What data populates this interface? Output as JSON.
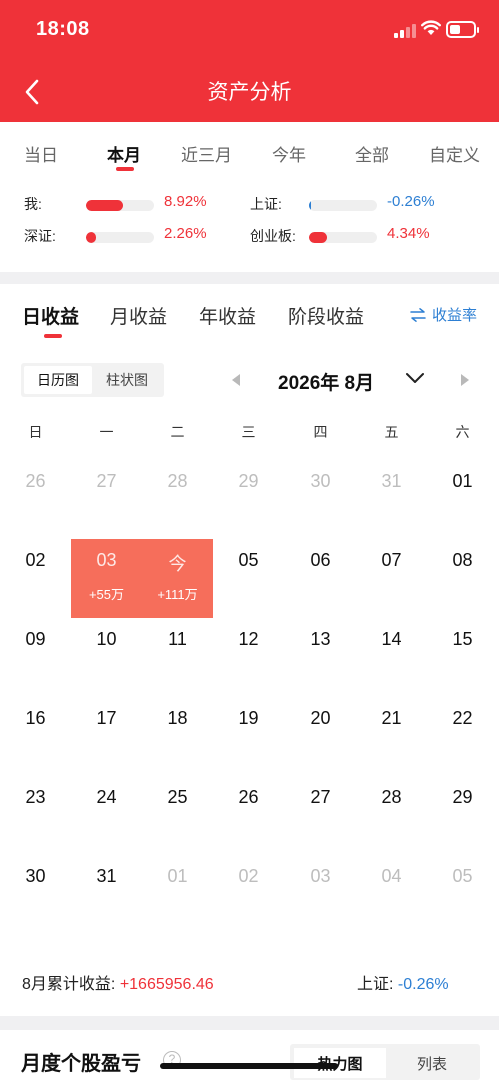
{
  "status_bar": {
    "time": "18:08"
  },
  "header": {
    "title": "资产分析",
    "back_icon": "chevron-left-icon"
  },
  "period_tabs": [
    {
      "label": "当日",
      "active": false
    },
    {
      "label": "本月",
      "active": true
    },
    {
      "label": "近三月",
      "active": false
    },
    {
      "label": "今年",
      "active": false
    },
    {
      "label": "全部",
      "active": false
    },
    {
      "label": "自定义",
      "active": false
    }
  ],
  "comparisons": [
    {
      "label": "我:",
      "value": "8.92%",
      "level": 0.55,
      "color": "#ef3239"
    },
    {
      "label": "上证:",
      "value": "-0.26%",
      "level": 0.03,
      "color": "#2d7fd3"
    },
    {
      "label": "深证:",
      "value": "2.26%",
      "level": 0.14,
      "color": "#ef3239"
    },
    {
      "label": "创业板:",
      "value": "4.34%",
      "level": 0.27,
      "color": "#ef3239"
    }
  ],
  "section_tabs": [
    {
      "label": "日收益",
      "active": true
    },
    {
      "label": "月收益",
      "active": false
    },
    {
      "label": "年收益",
      "active": false
    },
    {
      "label": "阶段收益",
      "active": false
    }
  ],
  "rate_toggle": {
    "label": "收益率",
    "icon": "swap-icon"
  },
  "view_toggle": {
    "calendar_label": "日历图",
    "bar_label": "柱状图"
  },
  "calendar": {
    "month_label": "2026年 8月",
    "weekdays": [
      "日",
      "一",
      "二",
      "三",
      "四",
      "五",
      "六"
    ],
    "days": [
      {
        "label": "26",
        "muted": true
      },
      {
        "label": "27",
        "muted": true
      },
      {
        "label": "28",
        "muted": true
      },
      {
        "label": "29",
        "muted": true
      },
      {
        "label": "30",
        "muted": true
      },
      {
        "label": "31",
        "muted": true
      },
      {
        "label": "01"
      },
      {
        "label": "02"
      },
      {
        "label": "03",
        "gain": "+55万",
        "highlight": true
      },
      {
        "label": "今",
        "gain": "+111万",
        "highlight": true
      },
      {
        "label": "05"
      },
      {
        "label": "06"
      },
      {
        "label": "07"
      },
      {
        "label": "08"
      },
      {
        "label": "09"
      },
      {
        "label": "10"
      },
      {
        "label": "11"
      },
      {
        "label": "12"
      },
      {
        "label": "13"
      },
      {
        "label": "14"
      },
      {
        "label": "15"
      },
      {
        "label": "16"
      },
      {
        "label": "17"
      },
      {
        "label": "18"
      },
      {
        "label": "19"
      },
      {
        "label": "20"
      },
      {
        "label": "21"
      },
      {
        "label": "22"
      },
      {
        "label": "23"
      },
      {
        "label": "24"
      },
      {
        "label": "25"
      },
      {
        "label": "26"
      },
      {
        "label": "27"
      },
      {
        "label": "28"
      },
      {
        "label": "29"
      },
      {
        "label": "30"
      },
      {
        "label": "31"
      },
      {
        "label": "01",
        "muted": true
      },
      {
        "label": "02",
        "muted": true
      },
      {
        "label": "03",
        "muted": true
      },
      {
        "label": "04",
        "muted": true
      },
      {
        "label": "05",
        "muted": true
      }
    ]
  },
  "summary": {
    "month_label": "8月累计收益:",
    "month_value": "+1665956.46",
    "index_label": "上证:",
    "index_value": "-0.26%"
  },
  "stock_section": {
    "title": "月度个股盈亏",
    "heatmap_label": "热力图",
    "list_label": "列表"
  }
}
